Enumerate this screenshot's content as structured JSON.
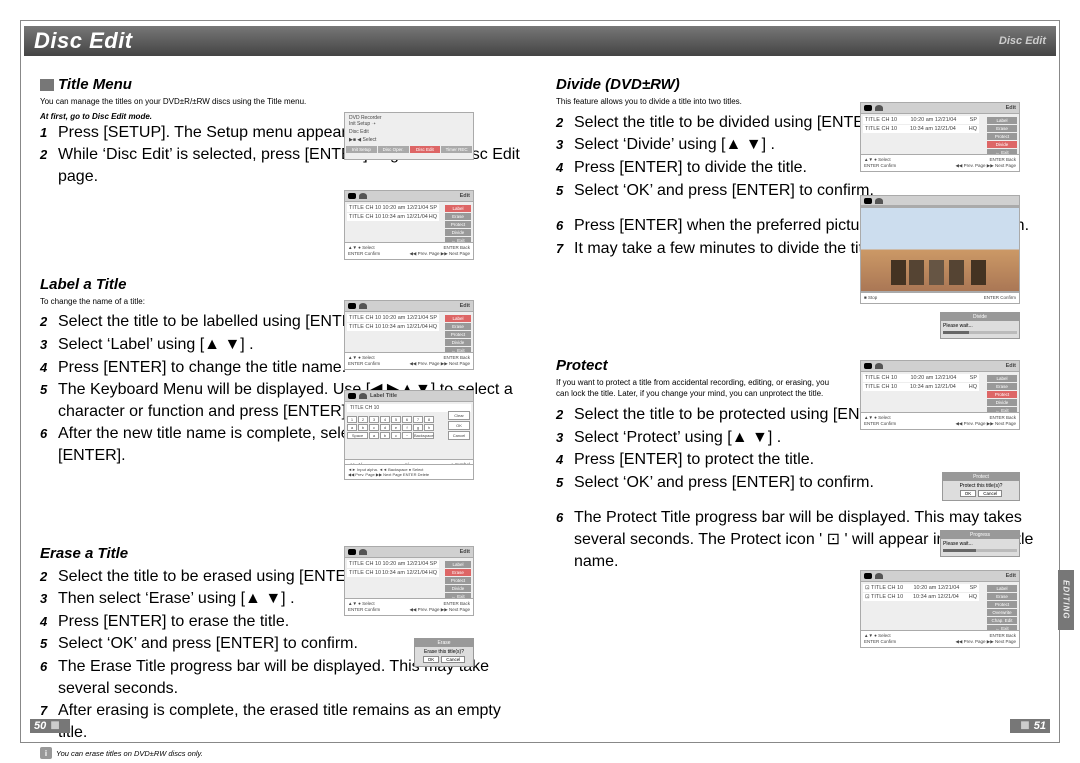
{
  "header": {
    "title": "Disc Edit",
    "right": "Disc Edit"
  },
  "leftPage": {
    "number": "50",
    "sections": {
      "titleMenu": {
        "heading": "Title Menu",
        "intro": "You can manage the titles on your DVD±R/±RW discs using the Title menu.",
        "sub": "At first, go to Disc Edit mode.",
        "steps": [
          {
            "n": "1",
            "t": "Press [SETUP]. The Setup menu appears."
          },
          {
            "n": "2",
            "t": "While ‘Disc Edit’ is selected, press [ENTER] to go to the Disc Edit page."
          }
        ]
      },
      "labelTitle": {
        "heading": "Label a Title",
        "intro": "To change the name of a title:",
        "steps": [
          {
            "n": "2",
            "t": "Select the title to be labelled using [ENTER]."
          },
          {
            "n": "3",
            "t": "Select ‘Label’ using [▲ ▼] ."
          },
          {
            "n": "4",
            "t": "Press [ENTER] to change the title name."
          },
          {
            "n": "5",
            "t": "The Keyboard Menu will be displayed. Use [◀ ▶▲▼] to select a character or function and press [ENTER]."
          },
          {
            "n": "6",
            "t": "After the new title name is complete, select ‘OK’ and press [ENTER]."
          }
        ]
      },
      "eraseTitle": {
        "heading": "Erase a Title",
        "steps": [
          {
            "n": "2",
            "t": "Select the title to be erased using [ENTER]."
          },
          {
            "n": "3",
            "t": "Then select ‘Erase’ using [▲ ▼] ."
          },
          {
            "n": "4",
            "t": "Press [ENTER] to erase the title."
          },
          {
            "n": "5",
            "t": "Select ‘OK’ and press [ENTER] to confirm."
          },
          {
            "n": "6",
            "t": "The Erase Title progress bar will be displayed. This may take several seconds."
          },
          {
            "n": "7",
            "t": "After erasing is complete, the erased title remains as an empty title."
          }
        ],
        "note": "You can erase titles on DVD±RW discs only."
      }
    }
  },
  "rightPage": {
    "number": "51",
    "sections": {
      "divide": {
        "heading": "Divide (DVD±RW)",
        "intro": "This feature allows you to divide a title into two titles.",
        "steps": [
          {
            "n": "2",
            "t": "Select the title to be divided using [ENTER]."
          },
          {
            "n": "3",
            "t": "Select ‘Divide’ using [▲ ▼] ."
          },
          {
            "n": "4",
            "t": "Press [ENTER] to divide the title."
          },
          {
            "n": "5",
            "t": "Select ‘OK’ and press [ENTER] to confirm."
          },
          {
            "n": "6",
            "t": "Press [ENTER] when the preferred picture is on your TV screen."
          },
          {
            "n": "7",
            "t": "It may take a few minutes to divide the title."
          }
        ]
      },
      "protect": {
        "heading": "Protect",
        "intro": "If you want to protect a title from accidental recording, editing, or erasing, you can lock the title. Later, if you change your mind, you can unprotect the title.",
        "steps": [
          {
            "n": "2",
            "t": "Select the title to be protected using [ENTER]."
          },
          {
            "n": "3",
            "t": "Select ‘Protect’ using [▲ ▼] ."
          },
          {
            "n": "4",
            "t": "Press [ENTER] to protect the title."
          },
          {
            "n": "5",
            "t": "Select ‘OK’ and press [ENTER] to confirm."
          },
          {
            "n": "6",
            "t": "The Protect Title progress bar will be displayed. This may takes several seconds. The Protect icon ' ⊡ ' will appear in front of Title name."
          }
        ]
      }
    },
    "sideTab": "EDITING"
  },
  "mini": {
    "setupTop": {
      "l1": "DVD Recorder",
      "l2": "Init Setup ➝",
      "l3": "Disc Edit",
      "l4": "▶■ ◀ Select",
      "tabs": {
        "a": "Init Setup",
        "b": "Disc Oper.",
        "c": "Disc Edit",
        "d": "Timer REC"
      }
    },
    "edit": {
      "hdr": "Edit",
      "row1a": "TITLE CH 10",
      "row1b": "10:20 am 12/21/04",
      "row1c": "SP",
      "row2a": "TITLE CH 10",
      "row2b": "10:34 am 12/21/04",
      "row2c": "HQ",
      "btns": {
        "label": "Label",
        "erase": "Erase",
        "protect": "Protect",
        "divide": "Divide",
        "overwrite": "Overwrite",
        "chapedit": "Chap. Edit",
        "exit": "← Exit"
      },
      "foot1a": "▲▼ ● Select",
      "foot1b": "ENTER Back",
      "foot2a": "ENTER Confirm",
      "foot2b": "◀◀  Prev. Page      ▶▶  Next Page"
    },
    "labelTitle": {
      "hdr": "Label Title",
      "val": "TITLE CH 10",
      "right": {
        "a": "Clear",
        "b": "OK",
        "c": "Cancel"
      },
      "rowA": "◄►  A/",
      "rowB": "a/",
      "rowC": "○ Symbol",
      "foot1": "◄► Input alpha.   ◄◄ Backspace   ● Select",
      "foot2": "◀◀  Prev. Page   ▶▶  Next Page   ENTER Delete"
    },
    "erase": {
      "hdr": "Erase",
      "msg": "Erase this title(s)?",
      "ok": "OK",
      "cancel": "Cancel"
    },
    "divideDlg": {
      "hdr": "Divide",
      "msg": "Please wait..."
    },
    "protectDlg": {
      "hdr": "Protect",
      "msg": "Protect this title(s)?",
      "ok": "OK",
      "cancel": "Cancel"
    },
    "progress": {
      "hdr": "Progress",
      "msg": "Please wait..."
    },
    "stop": {
      "l": "■ Stop",
      "r": "ENTER Confirm"
    }
  }
}
